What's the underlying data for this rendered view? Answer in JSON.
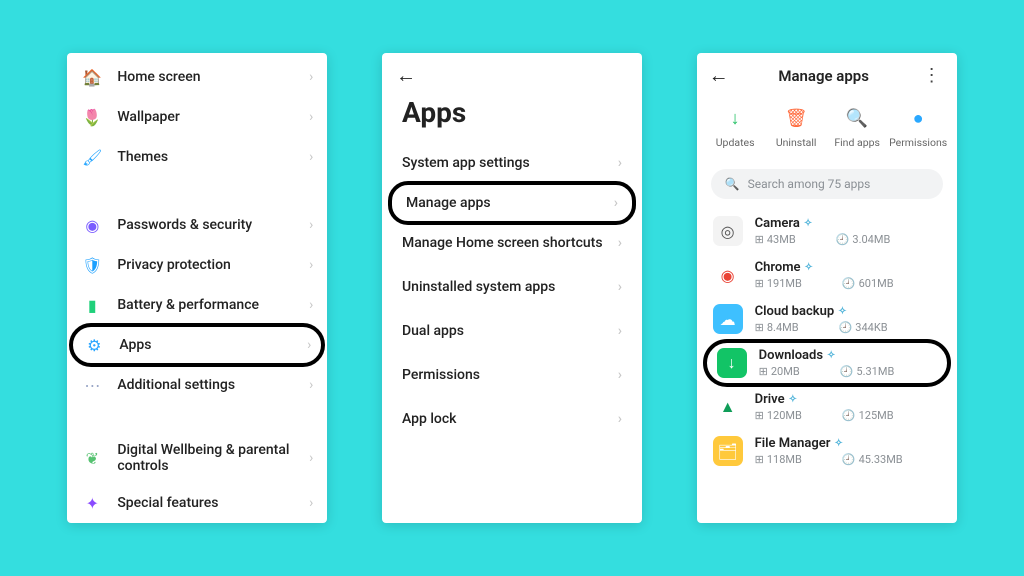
{
  "screen1": {
    "rows_a": [
      {
        "label": "Home screen",
        "icon": "🏠",
        "color": "#4a6bff"
      },
      {
        "label": "Wallpaper",
        "icon": "🌷",
        "color": "#ff4a8d"
      },
      {
        "label": "Themes",
        "icon": "🖌",
        "color": "#27a6ff"
      }
    ],
    "rows_b": [
      {
        "label": "Passwords & security",
        "icon": "◉",
        "color": "#7a5cff"
      },
      {
        "label": "Privacy protection",
        "icon": "🛡",
        "color": "#1aa0ff"
      },
      {
        "label": "Battery & performance",
        "icon": "▮",
        "color": "#1fd07a"
      }
    ],
    "apps_row": {
      "label": "Apps",
      "icon": "⚙",
      "color": "#2ba6ff"
    },
    "additional": {
      "label": "Additional settings",
      "icon": "⋯",
      "color": "#9aa7c7"
    },
    "rows_c": [
      {
        "label": "Digital Wellbeing & parental controls",
        "icon": "❦",
        "color": "#56c271"
      },
      {
        "label": "Special features",
        "icon": "✦",
        "color": "#8a4bff"
      }
    ]
  },
  "screen2": {
    "title": "Apps",
    "rows_pre": [
      "System app settings"
    ],
    "highlight": "Manage apps",
    "rows_post": [
      "Manage Home screen shortcuts",
      "Uninstalled system apps",
      "Dual apps",
      "Permissions",
      "App lock"
    ]
  },
  "screen3": {
    "title": "Manage apps",
    "actions": [
      {
        "label": "Updates",
        "icon": "↓",
        "bg": "#21c063"
      },
      {
        "label": "Uninstall",
        "icon": "🗑",
        "bg": "#ff6a3c"
      },
      {
        "label": "Find apps",
        "icon": "🔍",
        "bg": "#ffc63a"
      },
      {
        "label": "Permissions",
        "icon": "●",
        "bg": "#2aa8ff"
      }
    ],
    "search_placeholder": "Search among 75 apps",
    "apps_pre": [
      {
        "name": "Camera",
        "size1": "43MB",
        "size2": "3.04MB",
        "bg": "#f3f3f3",
        "glyph": "◎",
        "gcolor": "#555"
      },
      {
        "name": "Chrome",
        "size1": "191MB",
        "size2": "601MB",
        "bg": "#fff",
        "glyph": "◉",
        "gcolor": "#ea4335"
      },
      {
        "name": "Cloud backup",
        "size1": "8.4MB",
        "size2": "344KB",
        "bg": "#3ec0ff",
        "glyph": "☁",
        "gcolor": "#fff"
      }
    ],
    "highlight_app": {
      "name": "Downloads",
      "size1": "20MB",
      "size2": "5.31MB",
      "bg": "#12c466",
      "glyph": "↓",
      "gcolor": "#fff"
    },
    "apps_post": [
      {
        "name": "Drive",
        "size1": "120MB",
        "size2": "125MB",
        "bg": "#fff",
        "glyph": "▲",
        "gcolor": "#0f9d58"
      },
      {
        "name": "File Manager",
        "size1": "118MB",
        "size2": "45.33MB",
        "bg": "#ffc93c",
        "glyph": "🗂",
        "gcolor": "#fff"
      }
    ]
  }
}
